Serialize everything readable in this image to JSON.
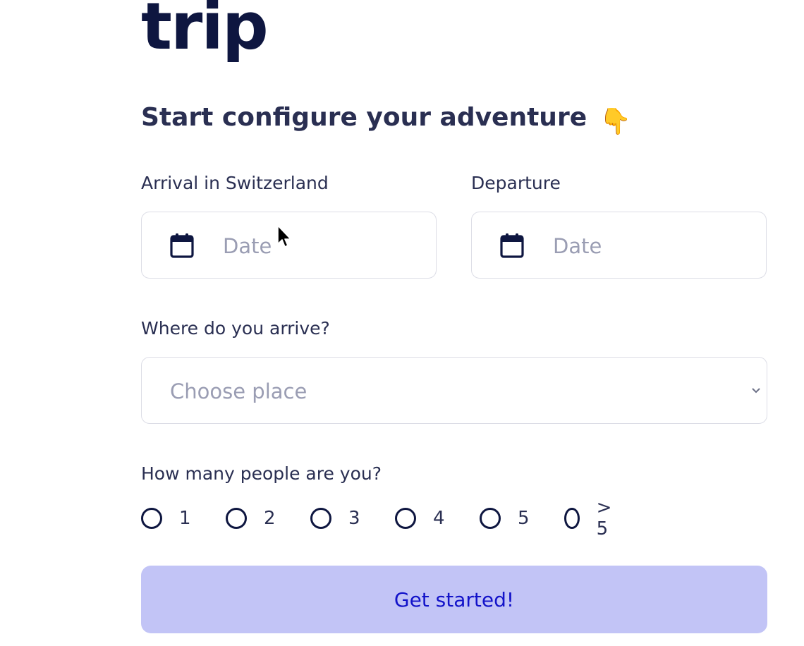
{
  "header": {
    "title": "trip",
    "subtitle": "Start configure your adventure",
    "subtitle_emoji": "👇",
    "subtitle_emoji_icon": "pointing-down-hand-icon"
  },
  "form": {
    "arrival": {
      "label": "Arrival in Switzerland",
      "placeholder": "Date",
      "icon": "calendar-icon"
    },
    "departure": {
      "label": "Departure",
      "placeholder": "Date",
      "icon": "calendar-icon"
    },
    "place": {
      "label": "Where do you arrive?",
      "placeholder": "Choose place",
      "icon": "chevron-down-icon"
    },
    "people": {
      "label": "How many people are you?",
      "options": [
        "1",
        "2",
        "3",
        "4",
        "5",
        "> 5"
      ],
      "selected": null
    },
    "submit_label": "Get started!"
  },
  "colors": {
    "title": "#0e1640",
    "text": "#2a2f52",
    "placeholder": "#9a9db3",
    "border": "#dcdde6",
    "button_bg": "#c2c4f6",
    "button_text": "#1212c9"
  }
}
